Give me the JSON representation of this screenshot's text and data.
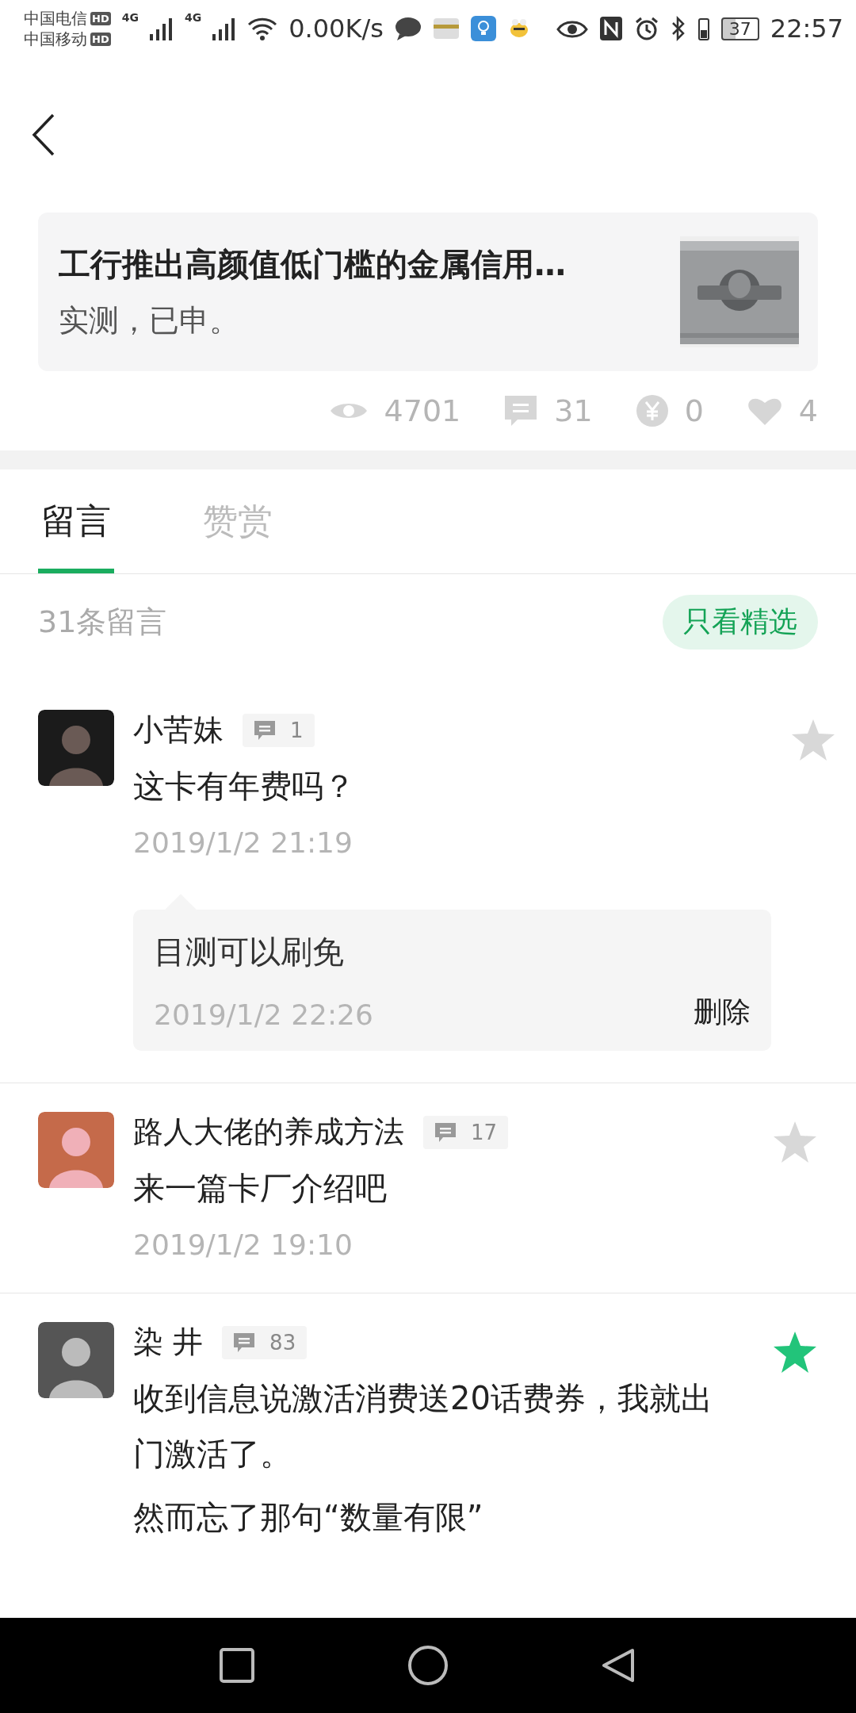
{
  "status_bar": {
    "carriers": [
      {
        "name": "中国电信",
        "badge": "HD"
      },
      {
        "name": "中国移动",
        "badge": "HD"
      }
    ],
    "networks": [
      "4G",
      "4G"
    ],
    "speed": "0.00K/s",
    "battery": "37",
    "time": "22:57"
  },
  "article": {
    "title": "工行推出高颜值低门槛的金属信用…",
    "summary": "实测，已申。"
  },
  "stats": [
    {
      "kind": "views",
      "value": "4701"
    },
    {
      "kind": "comments",
      "value": "31"
    },
    {
      "kind": "rewards",
      "value": "0"
    },
    {
      "kind": "likes",
      "value": "4"
    }
  ],
  "tabs": [
    {
      "label": "留言",
      "selected": true
    },
    {
      "label": "赞赏",
      "selected": false
    }
  ],
  "comment_count": "31条留言",
  "filter_button": "只看精选",
  "comments": [
    {
      "name": "小苦妹",
      "replies": "1",
      "text": "这卡有年费吗？",
      "time": "2019/1/2 21:19",
      "starred": false,
      "reply": {
        "text": "目测可以刷免",
        "time": "2019/1/2 22:26",
        "action": "删除"
      }
    },
    {
      "name": "路人大佬的养成方法",
      "replies": "17",
      "text": "来一篇卡厂介绍吧",
      "time": "2019/1/2 19:10",
      "starred": false
    },
    {
      "name": "染 井",
      "replies": "83",
      "text": "收到信息说激活消费送20话费券，我就出门激活了。",
      "text_2": "然而忘了那句“数量有限”",
      "starred": true
    }
  ]
}
